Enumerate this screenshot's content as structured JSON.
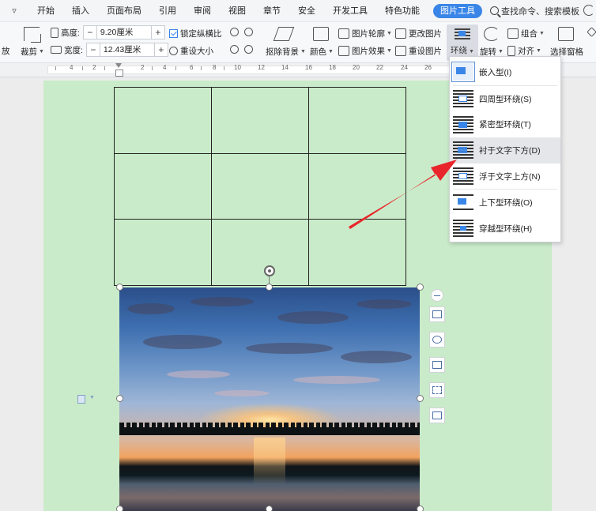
{
  "menubar": {
    "caret": "▿",
    "tabs": [
      "开始",
      "插入",
      "页面布局",
      "引用",
      "审阅",
      "视图",
      "章节",
      "安全",
      "开发工具",
      "特色功能"
    ],
    "active_tab": "图片工具",
    "search": "查找命令、搜索模板"
  },
  "toolbar": {
    "fang_label": "放",
    "crop_label": "裁剪",
    "height_label": "高度:",
    "height_value": "9.20厘米",
    "width_label": "宽度:",
    "width_value": "12.43厘米",
    "lock_ratio_label": "锁定纵横比",
    "reset_size_label": "重设大小",
    "remove_bg_label": "抠除背景",
    "color_label": "颜色",
    "outline_label": "图片轮廓",
    "effect_label": "图片效果",
    "change_pic_label": "更改图片",
    "reset_pic_label": "重设图片",
    "wrap_label": "环绕",
    "rotate_label": "旋转",
    "group_label": "组合",
    "align_label": "对齐",
    "select_pane_label": "选择窗格",
    "minus": "−",
    "plus": "+"
  },
  "ruler": {
    "numbers": [
      "4",
      "2",
      "2",
      "4",
      "6",
      "8",
      "10",
      "12",
      "14",
      "16",
      "18",
      "20",
      "22",
      "24",
      "26"
    ]
  },
  "wrap_menu": {
    "items": [
      {
        "label": "嵌入型(I)",
        "icon": "wrap-inline-icon"
      },
      {
        "label": "四周型环绕(S)",
        "icon": "wrap-square-icon"
      },
      {
        "label": "紧密型环绕(T)",
        "icon": "wrap-tight-icon"
      },
      {
        "label": "衬于文字下方(D)",
        "icon": "wrap-behind-icon"
      },
      {
        "label": "浮于文字上方(N)",
        "icon": "wrap-front-icon"
      },
      {
        "label": "上下型环绕(O)",
        "icon": "wrap-topbottom-icon"
      },
      {
        "label": "穿越型环绕(H)",
        "icon": "wrap-through-icon"
      }
    ],
    "selected_index": 0,
    "hover_index": 3
  },
  "colors": {
    "accent": "#3a86e8",
    "page_bg": "#c9ebc9",
    "arrow": "#e8262b"
  }
}
